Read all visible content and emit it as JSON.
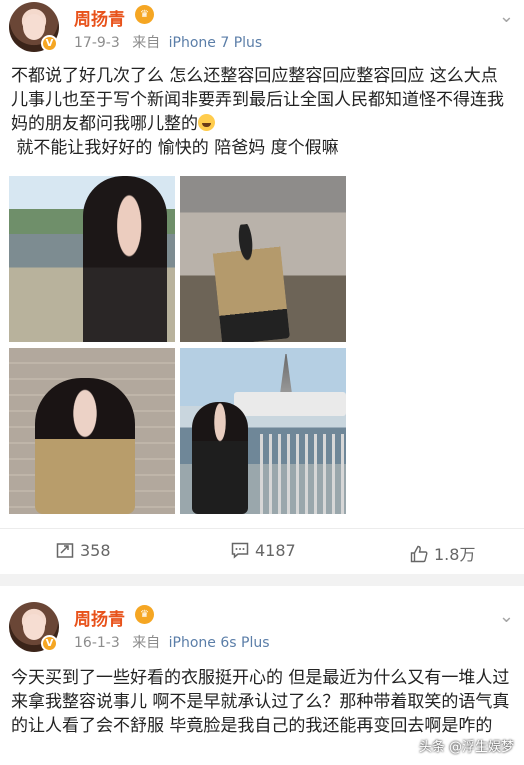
{
  "post1": {
    "username": "周扬青",
    "date": "17-9-3",
    "source_prefix": "来自",
    "source": "iPhone 7 Plus",
    "text": "不都说了好几次了么 怎么还整容回应整容回应整容回应 这么大点儿事儿也至于写个新闻非要弄到最后让全国人民都知道怪不得连我妈的朋友都问我哪儿整的",
    "text2": " 就不能让我好好的 愉快的 陪爸妈 度个假嘛",
    "repost_count": "358",
    "comment_count": "4187",
    "like_count": "1.8万"
  },
  "post2": {
    "username": "周扬青",
    "date": "16-1-3",
    "source_prefix": "来自",
    "source": "iPhone 6s Plus",
    "text": "今天买到了一些好看的衣服挺开心的 但是最近为什么又有一堆人过来拿我整容说事儿 啊不是早就承认过了么？那种带着取笑的语气真的让人看了会不舒服 毕竟脸是我自己的我还能再变回去啊是咋的"
  },
  "watermark": "头条 @浮生娱梦",
  "colors": {
    "username": "#e8521b",
    "source_link": "#5b7ea8",
    "meta": "#8c8c8c"
  }
}
